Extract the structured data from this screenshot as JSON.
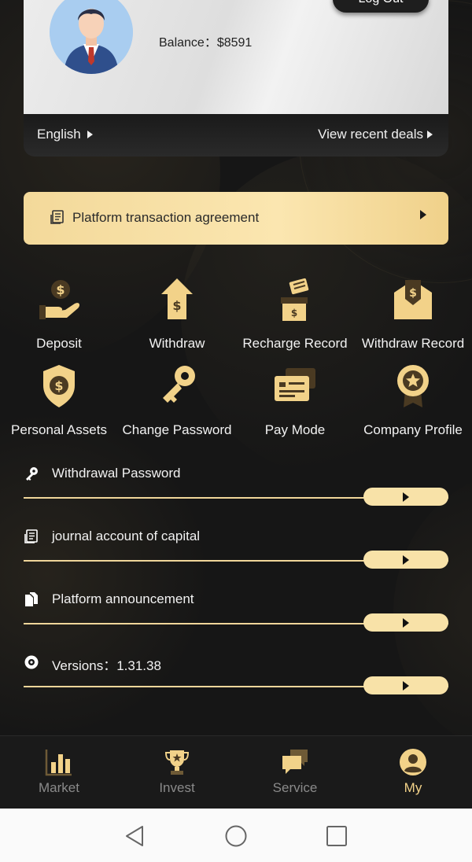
{
  "profile": {
    "balance": "Balance：$8591",
    "logout_label": "Log Out",
    "language": "English",
    "recent_deals": "View recent deals"
  },
  "agreement": {
    "label": "Platform transaction agreement"
  },
  "grid": [
    {
      "label": "Deposit",
      "icon": "deposit-icon"
    },
    {
      "label": "Withdraw",
      "icon": "withdraw-icon"
    },
    {
      "label": "Recharge Record",
      "icon": "recharge-record-icon"
    },
    {
      "label": "Withdraw Record",
      "icon": "withdraw-record-icon"
    },
    {
      "label": "Personal Assets",
      "icon": "personal-assets-icon"
    },
    {
      "label": "Change Password",
      "icon": "key-icon"
    },
    {
      "label": "Pay Mode",
      "icon": "pay-mode-icon"
    },
    {
      "label": "Company Profile",
      "icon": "company-profile-icon"
    }
  ],
  "list": [
    {
      "label": "Withdrawal Password",
      "icon": "key-icon"
    },
    {
      "label": "journal account of capital",
      "icon": "journal-icon"
    },
    {
      "label": "Platform announcement",
      "icon": "document-icon"
    },
    {
      "label": "Versions：1.31.38",
      "icon": "disc-icon"
    }
  ],
  "tabs": [
    {
      "label": "Market",
      "icon": "bar-chart-icon",
      "active": false
    },
    {
      "label": "Invest",
      "icon": "trophy-icon",
      "active": false
    },
    {
      "label": "Service",
      "icon": "chat-icon",
      "active": false
    },
    {
      "label": "My",
      "icon": "user-icon",
      "active": true
    }
  ],
  "colors": {
    "accent": "#f2d289",
    "background": "#161616",
    "agreement_bg": "#f8e2a8"
  }
}
